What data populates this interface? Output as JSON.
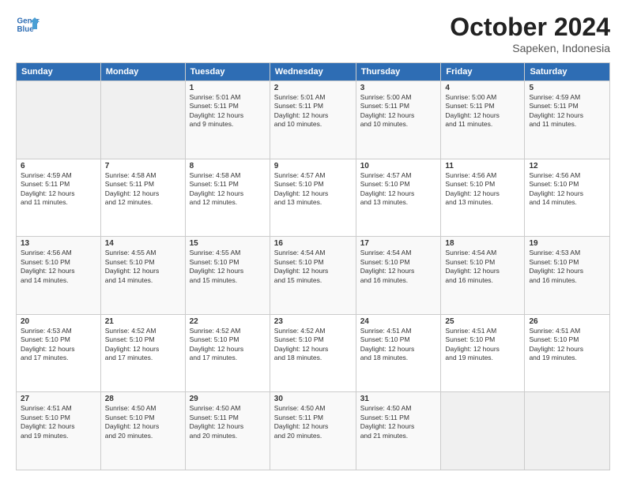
{
  "logo": {
    "line1": "General",
    "line2": "Blue"
  },
  "title": "October 2024",
  "subtitle": "Sapeken, Indonesia",
  "days_header": [
    "Sunday",
    "Monday",
    "Tuesday",
    "Wednesday",
    "Thursday",
    "Friday",
    "Saturday"
  ],
  "weeks": [
    [
      {
        "day": "",
        "info": ""
      },
      {
        "day": "",
        "info": ""
      },
      {
        "day": "1",
        "info": "Sunrise: 5:01 AM\nSunset: 5:11 PM\nDaylight: 12 hours\nand 9 minutes."
      },
      {
        "day": "2",
        "info": "Sunrise: 5:01 AM\nSunset: 5:11 PM\nDaylight: 12 hours\nand 10 minutes."
      },
      {
        "day": "3",
        "info": "Sunrise: 5:00 AM\nSunset: 5:11 PM\nDaylight: 12 hours\nand 10 minutes."
      },
      {
        "day": "4",
        "info": "Sunrise: 5:00 AM\nSunset: 5:11 PM\nDaylight: 12 hours\nand 11 minutes."
      },
      {
        "day": "5",
        "info": "Sunrise: 4:59 AM\nSunset: 5:11 PM\nDaylight: 12 hours\nand 11 minutes."
      }
    ],
    [
      {
        "day": "6",
        "info": "Sunrise: 4:59 AM\nSunset: 5:11 PM\nDaylight: 12 hours\nand 11 minutes."
      },
      {
        "day": "7",
        "info": "Sunrise: 4:58 AM\nSunset: 5:11 PM\nDaylight: 12 hours\nand 12 minutes."
      },
      {
        "day": "8",
        "info": "Sunrise: 4:58 AM\nSunset: 5:11 PM\nDaylight: 12 hours\nand 12 minutes."
      },
      {
        "day": "9",
        "info": "Sunrise: 4:57 AM\nSunset: 5:10 PM\nDaylight: 12 hours\nand 13 minutes."
      },
      {
        "day": "10",
        "info": "Sunrise: 4:57 AM\nSunset: 5:10 PM\nDaylight: 12 hours\nand 13 minutes."
      },
      {
        "day": "11",
        "info": "Sunrise: 4:56 AM\nSunset: 5:10 PM\nDaylight: 12 hours\nand 13 minutes."
      },
      {
        "day": "12",
        "info": "Sunrise: 4:56 AM\nSunset: 5:10 PM\nDaylight: 12 hours\nand 14 minutes."
      }
    ],
    [
      {
        "day": "13",
        "info": "Sunrise: 4:56 AM\nSunset: 5:10 PM\nDaylight: 12 hours\nand 14 minutes."
      },
      {
        "day": "14",
        "info": "Sunrise: 4:55 AM\nSunset: 5:10 PM\nDaylight: 12 hours\nand 14 minutes."
      },
      {
        "day": "15",
        "info": "Sunrise: 4:55 AM\nSunset: 5:10 PM\nDaylight: 12 hours\nand 15 minutes."
      },
      {
        "day": "16",
        "info": "Sunrise: 4:54 AM\nSunset: 5:10 PM\nDaylight: 12 hours\nand 15 minutes."
      },
      {
        "day": "17",
        "info": "Sunrise: 4:54 AM\nSunset: 5:10 PM\nDaylight: 12 hours\nand 16 minutes."
      },
      {
        "day": "18",
        "info": "Sunrise: 4:54 AM\nSunset: 5:10 PM\nDaylight: 12 hours\nand 16 minutes."
      },
      {
        "day": "19",
        "info": "Sunrise: 4:53 AM\nSunset: 5:10 PM\nDaylight: 12 hours\nand 16 minutes."
      }
    ],
    [
      {
        "day": "20",
        "info": "Sunrise: 4:53 AM\nSunset: 5:10 PM\nDaylight: 12 hours\nand 17 minutes."
      },
      {
        "day": "21",
        "info": "Sunrise: 4:52 AM\nSunset: 5:10 PM\nDaylight: 12 hours\nand 17 minutes."
      },
      {
        "day": "22",
        "info": "Sunrise: 4:52 AM\nSunset: 5:10 PM\nDaylight: 12 hours\nand 17 minutes."
      },
      {
        "day": "23",
        "info": "Sunrise: 4:52 AM\nSunset: 5:10 PM\nDaylight: 12 hours\nand 18 minutes."
      },
      {
        "day": "24",
        "info": "Sunrise: 4:51 AM\nSunset: 5:10 PM\nDaylight: 12 hours\nand 18 minutes."
      },
      {
        "day": "25",
        "info": "Sunrise: 4:51 AM\nSunset: 5:10 PM\nDaylight: 12 hours\nand 19 minutes."
      },
      {
        "day": "26",
        "info": "Sunrise: 4:51 AM\nSunset: 5:10 PM\nDaylight: 12 hours\nand 19 minutes."
      }
    ],
    [
      {
        "day": "27",
        "info": "Sunrise: 4:51 AM\nSunset: 5:10 PM\nDaylight: 12 hours\nand 19 minutes."
      },
      {
        "day": "28",
        "info": "Sunrise: 4:50 AM\nSunset: 5:10 PM\nDaylight: 12 hours\nand 20 minutes."
      },
      {
        "day": "29",
        "info": "Sunrise: 4:50 AM\nSunset: 5:11 PM\nDaylight: 12 hours\nand 20 minutes."
      },
      {
        "day": "30",
        "info": "Sunrise: 4:50 AM\nSunset: 5:11 PM\nDaylight: 12 hours\nand 20 minutes."
      },
      {
        "day": "31",
        "info": "Sunrise: 4:50 AM\nSunset: 5:11 PM\nDaylight: 12 hours\nand 21 minutes."
      },
      {
        "day": "",
        "info": ""
      },
      {
        "day": "",
        "info": ""
      }
    ]
  ]
}
